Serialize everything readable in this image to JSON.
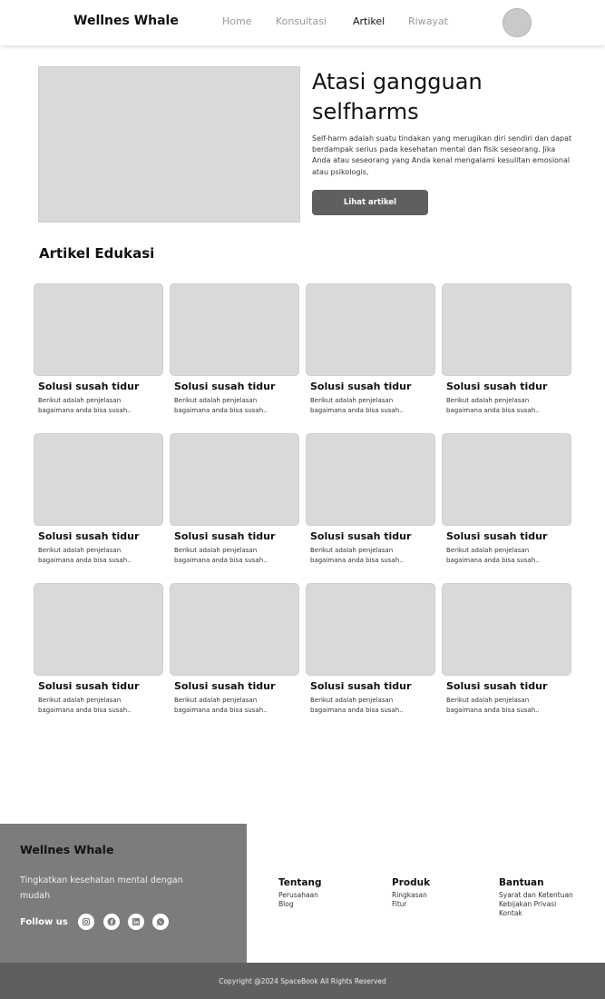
{
  "header": {
    "brand": "Wellnes Whale",
    "nav": [
      "Home",
      "Konsultasi",
      "Artikel",
      "Riwayat"
    ],
    "active_nav": "Artikel"
  },
  "hero": {
    "title": "Atasi gangguan selfharms",
    "description": "Self-harm adalah suatu tindakan yang merugikan diri sendiri dan dapat berdampak serius pada kesehatan mental dan fisik seseorang. Jika Anda atau seseorang yang Anda kenal mengalami kesulitan emosional atau psikologis,",
    "button_label": "Lihat artikel"
  },
  "section": {
    "title": "Artikel Edukasi"
  },
  "articles": [
    {
      "title": "Solusi susah tidur",
      "desc": "Berikut adalah penjelasan bagaimana anda bisa susah.."
    },
    {
      "title": "Solusi susah tidur",
      "desc": "Berikut adalah penjelasan bagaimana anda bisa susah.."
    },
    {
      "title": "Solusi susah tidur",
      "desc": "Berikut adalah penjelasan bagaimana anda bisa susah.."
    },
    {
      "title": "Solusi susah tidur",
      "desc": "Berikut adalah penjelasan bagaimana anda bisa susah.."
    },
    {
      "title": "Solusi susah tidur",
      "desc": "Berikut adalah penjelasan bagaimana anda bisa susah.."
    },
    {
      "title": "Solusi susah tidur",
      "desc": "Berikut adalah penjelasan bagaimana anda bisa susah.."
    },
    {
      "title": "Solusi susah tidur",
      "desc": "Berikut adalah penjelasan bagaimana anda bisa susah.."
    },
    {
      "title": "Solusi susah tidur",
      "desc": "Berikut adalah penjelasan bagaimana anda bisa susah.."
    },
    {
      "title": "Solusi susah tidur",
      "desc": "Berikut adalah penjelasan bagaimana anda bisa susah.."
    },
    {
      "title": "Solusi susah tidur",
      "desc": "Berikut adalah penjelasan bagaimana anda bisa susah.."
    },
    {
      "title": "Solusi susah tidur",
      "desc": "Berikut adalah penjelasan bagaimana anda bisa susah.."
    },
    {
      "title": "Solusi susah tidur",
      "desc": "Berikut adalah penjelasan bagaimana anda bisa susah.."
    }
  ],
  "footer": {
    "brand": "Wellnes Whale",
    "tagline": "Tingkatkan kesehatan mental dengan mudah",
    "follow_label": "Follow us",
    "social_icons": [
      "instagram-icon",
      "facebook-icon",
      "linkedin-icon",
      "whatsapp-icon"
    ],
    "columns": [
      {
        "title": "Tentang",
        "links": [
          "Perusahaan",
          "Blog"
        ]
      },
      {
        "title": "Produk",
        "links": [
          "Ringkasan",
          "Fitur"
        ]
      },
      {
        "title": "Bantuan",
        "links": [
          "Syarat dan Ketentuan",
          "Kebijakan Privasi",
          "Kontak"
        ]
      }
    ],
    "copyright": "Copyright @2024  SpaceBook All Rights Reserved"
  },
  "colors": {
    "placeholder": "#d9d9d9",
    "button": "#5f5f5f",
    "footer_panel": "#7c7c7c",
    "bottom_bar": "#5f5f5f"
  }
}
